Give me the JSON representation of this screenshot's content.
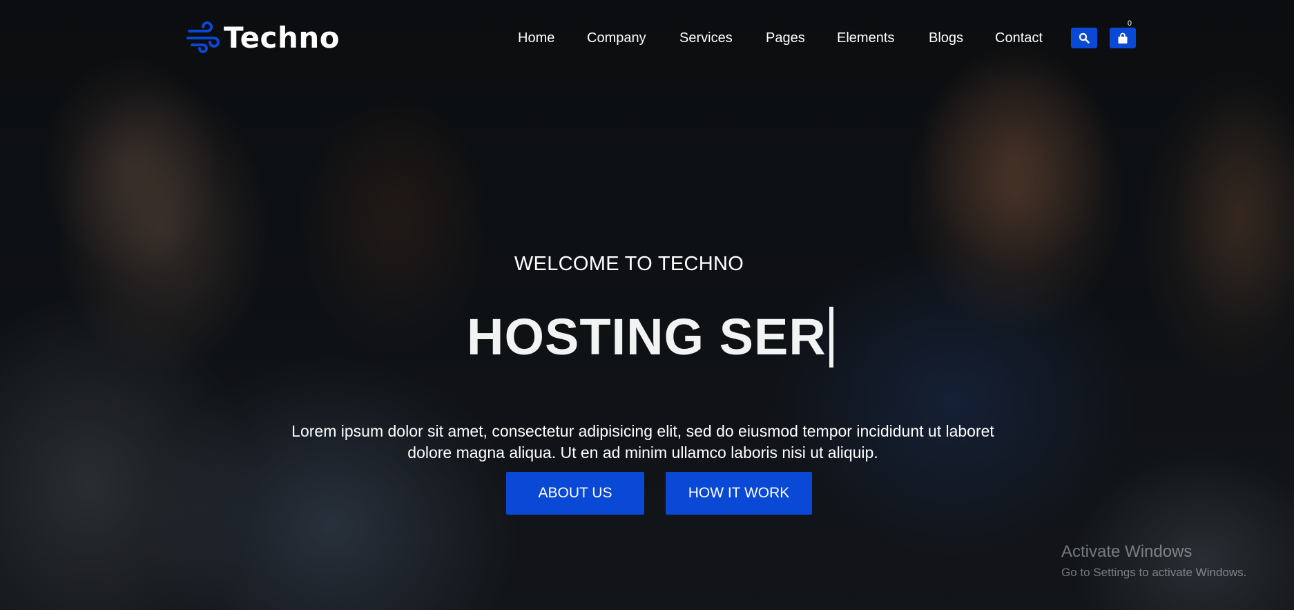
{
  "brand": {
    "name": "Techno",
    "accent": "#0a48d6"
  },
  "nav": {
    "items": [
      {
        "label": "Home"
      },
      {
        "label": "Company"
      },
      {
        "label": "Services"
      },
      {
        "label": "Pages"
      },
      {
        "label": "Elements"
      },
      {
        "label": "Blogs"
      },
      {
        "label": "Contact"
      }
    ],
    "search_icon": "search-icon",
    "cart_icon": "shopping-bag-icon",
    "cart_count": "0"
  },
  "hero": {
    "eyebrow": "WELCOME TO TECHNO",
    "headline": "HOSTING SER",
    "description": "Lorem ipsum dolor sit amet, consectetur adipisicing elit, sed do eiusmod tempor incididunt ut laboret dolore magna aliqua. Ut en ad minim ullamco laboris nisi ut aliquip.",
    "primary_button": "ABOUT US",
    "secondary_button": "HOW IT WORK"
  },
  "os_watermark": {
    "title": "Activate Windows",
    "subtitle": "Go to Settings to activate Windows."
  }
}
